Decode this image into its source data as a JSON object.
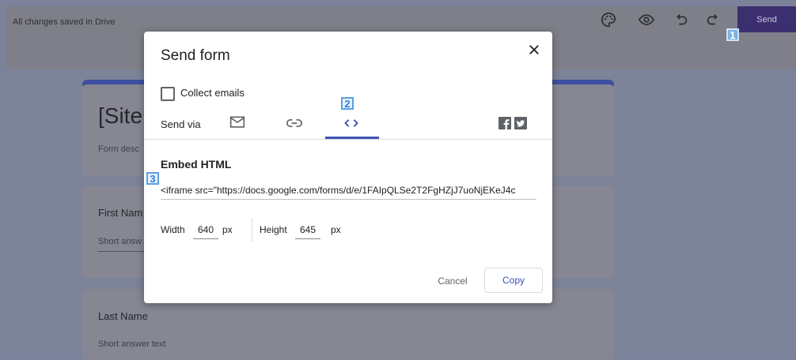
{
  "topbar": {
    "saved_status": "All changes saved in Drive",
    "icons": [
      "palette-icon",
      "preview-eye-icon",
      "undo-icon",
      "redo-icon"
    ],
    "send_label": "Send",
    "send_color": "#673ab7"
  },
  "annotations": {
    "badge_1": "1",
    "badge_2": "2",
    "badge_3": "3"
  },
  "background_form": {
    "title": "[Site",
    "description": "Form desc",
    "questions": [
      {
        "title": "First Nam",
        "placeholder": "Short answ"
      },
      {
        "title": "Last Name",
        "placeholder": "Short answer text"
      }
    ],
    "accent_color": "#673ab7"
  },
  "dialog": {
    "title": "Send form",
    "collect_emails_label": "Collect emails",
    "collect_emails_checked": false,
    "send_via_label": "Send via",
    "tabs": [
      "email-icon",
      "link-icon",
      "embed-code-icon"
    ],
    "active_tab": "embed-code-icon",
    "social": [
      "facebook-icon",
      "twitter-icon"
    ],
    "embed_heading": "Embed HTML",
    "embed_code": "<iframe src=\"https://docs.google.com/forms/d/e/1FAIpQLSe2T2FgHZjJ7uoNjEKeJ4c",
    "width_label": "Width",
    "width_value": "640",
    "width_unit": "px",
    "height_label": "Height",
    "height_value": "645",
    "height_unit": "px",
    "cancel_label": "Cancel",
    "copy_label": "Copy",
    "accent_color": "#3f51b5"
  }
}
